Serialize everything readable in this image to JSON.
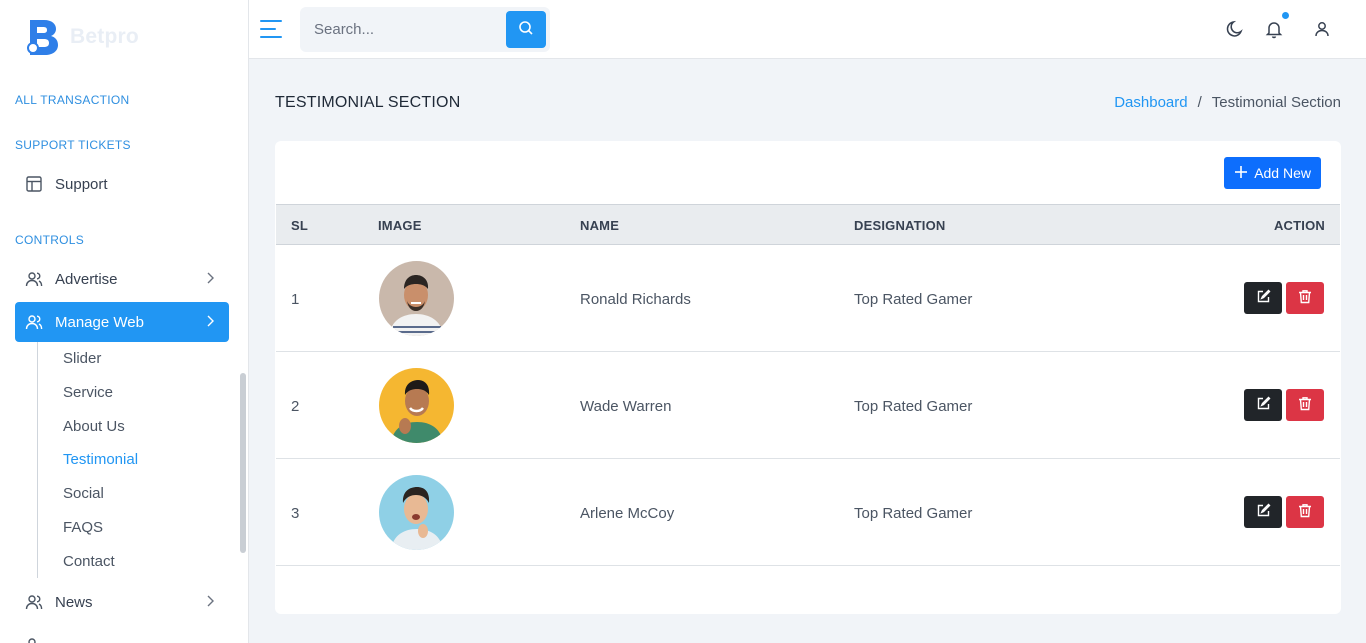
{
  "brand": {
    "name": "Betpro"
  },
  "sidebar": {
    "section_all_transaction": "ALL TRANSACTION",
    "section_support": "SUPPORT TICKETS",
    "support_label": "Support",
    "section_controls": "CONTROLS",
    "advertise_label": "Advertise",
    "manage_web_label": "Manage Web",
    "submenu": [
      "Slider",
      "Service",
      "About Us",
      "Testimonial",
      "Social",
      "FAQS",
      "Contact"
    ],
    "news_label": "News",
    "active_submenu": "Testimonial"
  },
  "topbar": {
    "search_placeholder": "Search...",
    "has_notification": true
  },
  "page": {
    "title": "TESTIMONIAL SECTION",
    "breadcrumb_home": "Dashboard",
    "breadcrumb_sep": "/",
    "breadcrumb_current": "Testimonial Section"
  },
  "table": {
    "add_label": "Add New",
    "headers": {
      "sl": "SL",
      "image": "IMAGE",
      "name": "NAME",
      "designation": "DESIGNATION",
      "action": "ACTION"
    },
    "rows": [
      {
        "sl": "1",
        "name": "Ronald Richards",
        "designation": "Top Rated Gamer",
        "avatar_bg": "#c9b8ab"
      },
      {
        "sl": "2",
        "name": "Wade Warren",
        "designation": "Top Rated Gamer",
        "avatar_bg": "#f5b731"
      },
      {
        "sl": "3",
        "name": "Arlene McCoy",
        "designation": "Top Rated Gamer",
        "avatar_bg": "#8fd0e6"
      }
    ]
  },
  "colors": {
    "accent": "#2196f3",
    "primary_button": "#0d6efd",
    "edit_button": "#212529",
    "delete_button": "#dc3545"
  }
}
